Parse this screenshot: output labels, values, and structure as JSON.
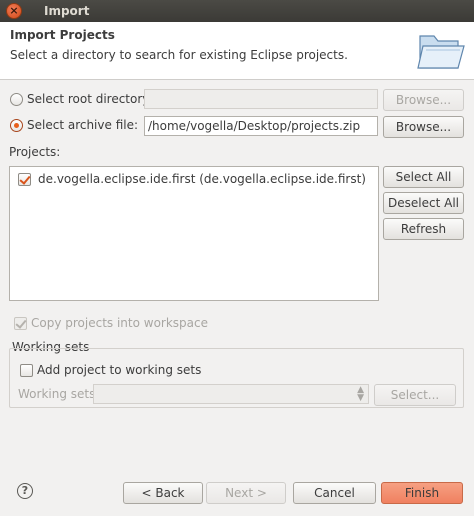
{
  "window": {
    "title": "Import",
    "close_glyph": "×"
  },
  "header": {
    "title": "Import Projects",
    "description": "Select a directory to search for existing Eclipse projects."
  },
  "source": {
    "root_directory": {
      "label": "Select root directory:",
      "selected": false,
      "value": "",
      "browse_label": "Browse...",
      "enabled": false
    },
    "archive_file": {
      "label": "Select archive file:",
      "selected": true,
      "value": "/home/vogella/Desktop/projects.zip",
      "browse_label": "Browse..."
    }
  },
  "projects": {
    "label": "Projects:",
    "items": [
      {
        "label": "de.vogella.eclipse.ide.first (de.vogella.eclipse.ide.first)",
        "checked": true
      }
    ],
    "select_all_label": "Select All",
    "deselect_all_label": "Deselect All",
    "refresh_label": "Refresh"
  },
  "copy_projects": {
    "label": "Copy projects into workspace",
    "checked": true,
    "enabled": false
  },
  "working_sets": {
    "group_label": "Working sets",
    "add_label": "Add project to working sets",
    "add_checked": false,
    "sets_label": "Working sets:",
    "sets_value": "",
    "select_label": "Select..."
  },
  "footer": {
    "help_glyph": "?",
    "back_label": "< Back",
    "next_label": "Next >",
    "cancel_label": "Cancel",
    "finish_label": "Finish"
  },
  "colors": {
    "accent": "#e8601c",
    "finish_button": "#f08060"
  }
}
